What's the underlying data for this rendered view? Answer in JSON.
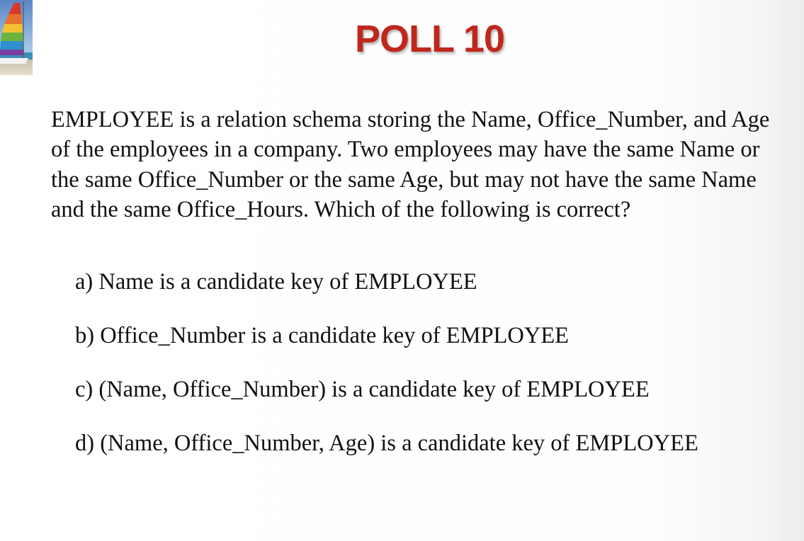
{
  "slide": {
    "title": "POLL 10",
    "question": "EMPLOYEE is a relation schema storing the Name, Office_Number, and Age of the employees in a company. Two employees may have the same Name or the same Office_Number or the same Age, but may not have the same Name and the same Office_Hours.  Which of the following is correct?",
    "options": [
      {
        "label": "a) Name is a candidate key of EMPLOYEE"
      },
      {
        "label": "b) Office_Number is a candidate key of EMPLOYEE"
      },
      {
        "label": "c) (Name, Office_Number) is a candidate key of EMPLOYEE"
      },
      {
        "label": "d) (Name, Office_Number, Age) is a candidate key of EMPLOYEE"
      }
    ]
  },
  "colors": {
    "title": "#c0271c",
    "text": "#111111",
    "background": "#ffffff"
  },
  "icons": {
    "logo": "sailboat-logo"
  }
}
